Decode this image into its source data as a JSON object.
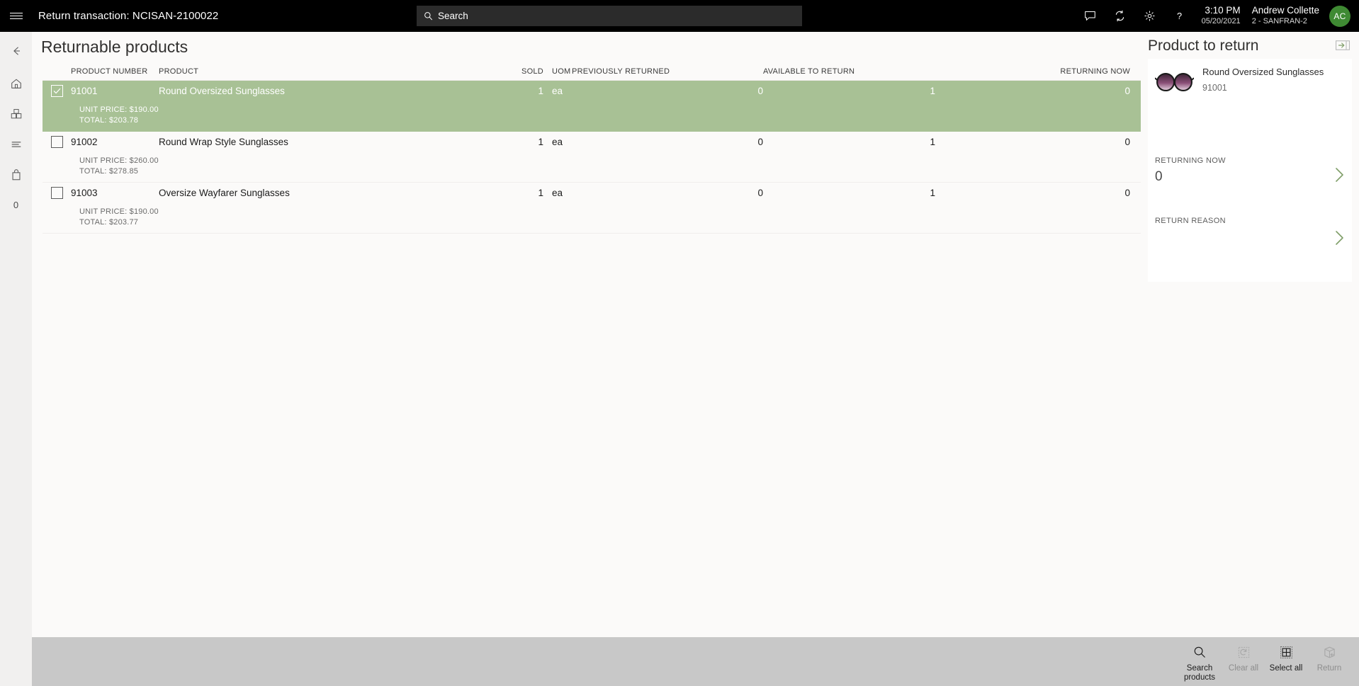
{
  "topbar": {
    "menu_icon": "hamburger-icon",
    "title": "Return transaction: NCISAN-2100022",
    "search": {
      "placeholder": "Search",
      "value": "",
      "icon": "search-icon"
    },
    "icons": [
      "message-icon",
      "sync-icon",
      "gear-icon",
      "help-icon"
    ],
    "time": "3:10 PM",
    "date": "05/20/2021",
    "user_name": "Andrew Collette",
    "user_store": "2 - SANFRAN-2",
    "avatar_initials": "AC",
    "avatar_color": "#3f8a33"
  },
  "rail": {
    "items": [
      {
        "name": "back-icon",
        "label": ""
      },
      {
        "name": "home-icon",
        "label": ""
      },
      {
        "name": "products-icon",
        "label": ""
      },
      {
        "name": "list-icon",
        "label": ""
      },
      {
        "name": "bag-icon",
        "label": ""
      }
    ],
    "count": "0"
  },
  "main": {
    "page_title": "Returnable products",
    "columns": [
      "PRODUCT NUMBER",
      "PRODUCT",
      "SOLD",
      "UOM",
      "PREVIOUSLY RETURNED",
      "AVAILABLE TO RETURN",
      "RETURNING NOW"
    ],
    "rows": [
      {
        "selected": true,
        "checked": true,
        "product_number": "91001",
        "product": "Round Oversized Sunglasses",
        "sold": "1",
        "uom": "ea",
        "previously_returned": "0",
        "available_to_return": "1",
        "returning_now": "0",
        "unit_price": "UNIT PRICE: $190.00",
        "total": "TOTAL: $203.78"
      },
      {
        "selected": false,
        "checked": false,
        "product_number": "91002",
        "product": "Round Wrap Style Sunglasses",
        "sold": "1",
        "uom": "ea",
        "previously_returned": "0",
        "available_to_return": "1",
        "returning_now": "0",
        "unit_price": "UNIT PRICE: $260.00",
        "total": "TOTAL: $278.85"
      },
      {
        "selected": false,
        "checked": false,
        "product_number": "91003",
        "product": "Oversize Wayfarer Sunglasses",
        "sold": "1",
        "uom": "ea",
        "previously_returned": "0",
        "available_to_return": "1",
        "returning_now": "0",
        "unit_price": "UNIT PRICE: $190.00",
        "total": "TOTAL: $203.77"
      }
    ]
  },
  "right_panel": {
    "title": "Product to return",
    "expand_icon": "expand-panel-icon",
    "product": {
      "name": "Round Oversized Sunglasses",
      "number": "91001",
      "image": "sunglasses-thumbnail"
    },
    "returning_now": {
      "label": "RETURNING NOW",
      "value": "0",
      "chevron": "chevron-right-icon"
    },
    "return_reason": {
      "label": "RETURN REASON",
      "value": "",
      "chevron": "chevron-right-icon"
    }
  },
  "bottom_bar": {
    "buttons": [
      {
        "label": "Search products",
        "icon": "search-icon",
        "enabled": true
      },
      {
        "label": "Clear all",
        "icon": "clear-icon",
        "enabled": false
      },
      {
        "label": "Select all",
        "icon": "select-all-icon",
        "enabled": true
      },
      {
        "label": "Return",
        "icon": "return-box-icon",
        "enabled": false
      }
    ]
  },
  "colors": {
    "selected_row": "#a8c195",
    "accent_green": "#7f9e68",
    "topbar_bg": "#000000",
    "rail_bg": "#f1f0ef",
    "content_bg": "#fbfaf9",
    "bottom_bar_bg": "#c8c8c8"
  }
}
